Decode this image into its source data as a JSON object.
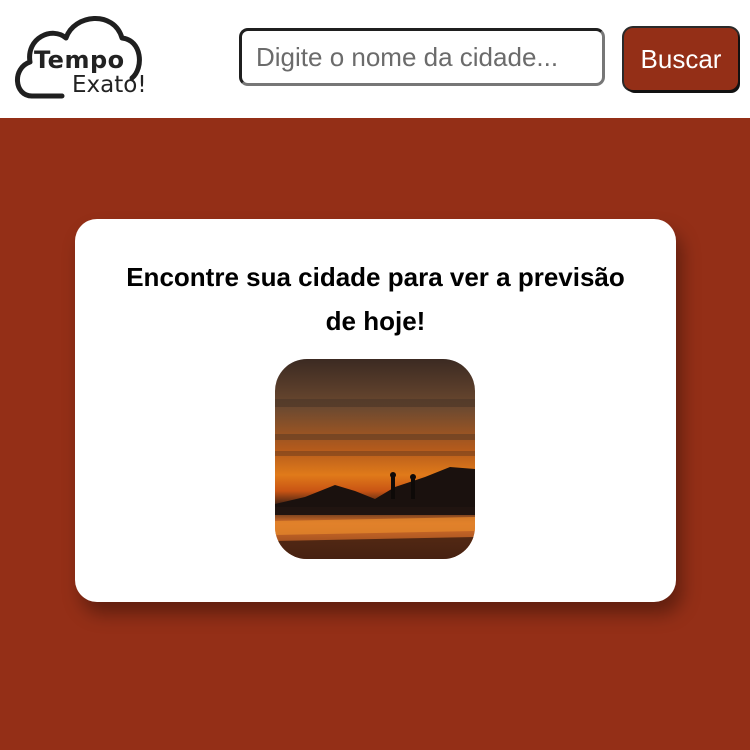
{
  "logo": {
    "line1": "Tempo",
    "line2": "Exato!"
  },
  "search": {
    "placeholder": "Digite o nome da cidade...",
    "value": ""
  },
  "button": {
    "label": "Buscar"
  },
  "card": {
    "heading": "Encontre sua cidade para ver a previsão de hoje!"
  },
  "colors": {
    "accent": "#942f17",
    "background": "#942f17",
    "card": "#ffffff"
  },
  "icons": {
    "logo_shape": "cloud-icon"
  }
}
